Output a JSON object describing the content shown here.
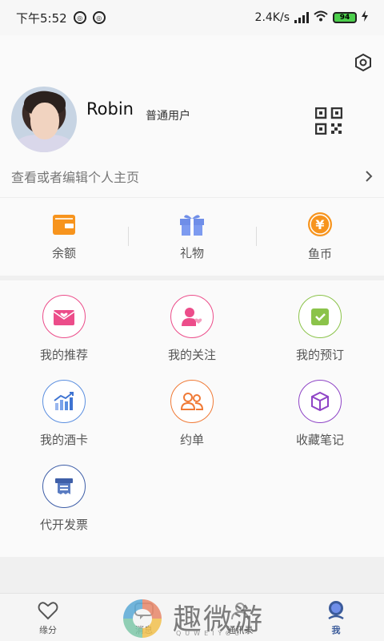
{
  "statusbar": {
    "time": "下午5:52",
    "network_speed": "2.4K/s",
    "battery": "94"
  },
  "profile": {
    "name": "Robin",
    "level": "普通用户",
    "edit_link": "查看或者编辑个人主页"
  },
  "wallet": [
    {
      "label": "余额",
      "icon": "wallet-icon",
      "color": "#f7941d"
    },
    {
      "label": "礼物",
      "icon": "gift-icon",
      "color": "#6f8ee8"
    },
    {
      "label": "鱼币",
      "icon": "coin-icon",
      "color": "#f7941d"
    }
  ],
  "menu": [
    {
      "label": "我的推荐",
      "icon": "envelope-heart-icon",
      "color": "#ec4d8a"
    },
    {
      "label": "我的关注",
      "icon": "user-heart-icon",
      "color": "#ec4d8a"
    },
    {
      "label": "我的预订",
      "icon": "calendar-check-icon",
      "color": "#8bc34a"
    },
    {
      "label": "我的酒卡",
      "icon": "chart-card-icon",
      "color": "#5b8fe0"
    },
    {
      "label": "约单",
      "icon": "users-icon",
      "color": "#f07a36"
    },
    {
      "label": "收藏笔记",
      "icon": "cube-icon",
      "color": "#8e44c6"
    },
    {
      "label": "代开发票",
      "icon": "invoice-icon",
      "color": "#3f5fa8"
    }
  ],
  "tabs": [
    {
      "label": "缘分",
      "icon": "heart-icon"
    },
    {
      "label": "消息",
      "icon": "message-icon"
    },
    {
      "label": "通讯录",
      "icon": "contacts-icon"
    },
    {
      "label": "我",
      "icon": "me-icon",
      "active": true
    }
  ],
  "watermark": {
    "text": "趣微游",
    "sub": "QUWEIYOU"
  }
}
